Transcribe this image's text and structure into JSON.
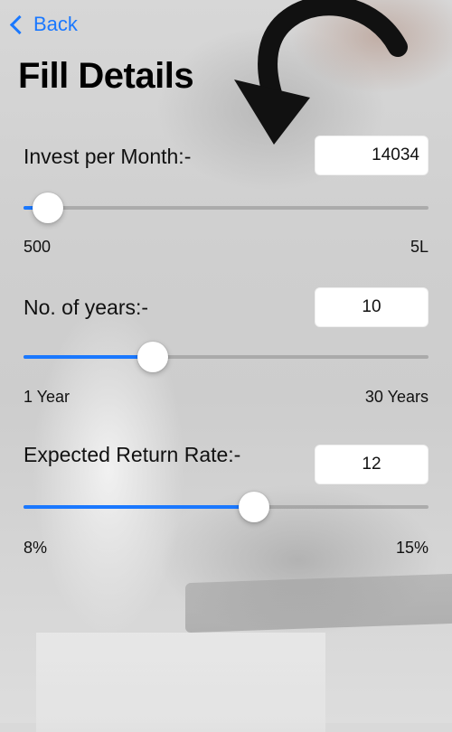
{
  "header": {
    "back_label": "Back",
    "title": "Fill Details"
  },
  "fields": [
    {
      "label": "Invest per Month:-",
      "value": "14034",
      "min_label": "500",
      "max_label": "5L",
      "slider_fraction": 0.06
    },
    {
      "label": "No. of years:-",
      "value": "10",
      "min_label": "1 Year",
      "max_label": "30 Years",
      "slider_fraction": 0.32
    },
    {
      "label": "Expected Return Rate:-",
      "value": "12",
      "min_label": "8%",
      "max_label": "15%",
      "slider_fraction": 0.57
    }
  ],
  "colors": {
    "accent": "#1a78ff",
    "track": "#8c8c8c",
    "input_bg": "#ffffff"
  }
}
